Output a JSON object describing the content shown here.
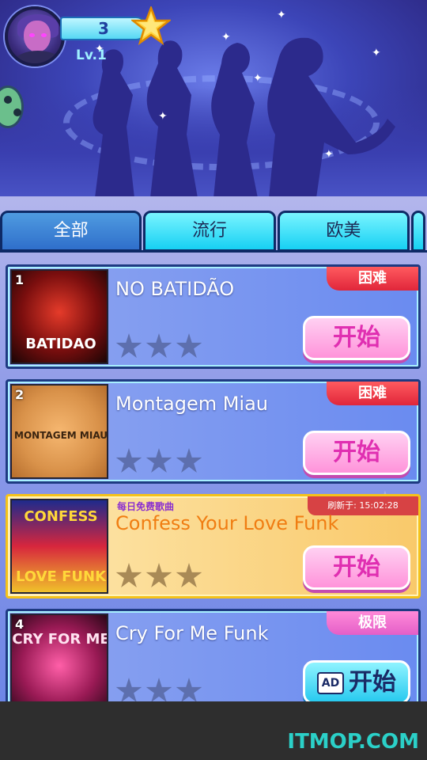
{
  "profile": {
    "score": "3",
    "level": "Lv.1"
  },
  "tabs": [
    {
      "label": "全部",
      "active": true
    },
    {
      "label": "流行",
      "active": false
    },
    {
      "label": "欧美",
      "active": false
    }
  ],
  "songs": [
    {
      "rank": "1",
      "title": "NO BATIDÃO",
      "difficulty": "困难",
      "stars": 3,
      "button": "开始",
      "cover_text": "BATIDAO"
    },
    {
      "rank": "2",
      "title": "Montagem Miau",
      "difficulty": "困难",
      "stars": 3,
      "button": "开始",
      "cover_text": "MONTAGEM MIAU"
    },
    {
      "rank": "",
      "title": "Confess Your Love Funk",
      "featured_label": "每日免费歌曲",
      "refresh_label": "刷新于: 15:02:28",
      "stars": 3,
      "button": "开始",
      "cover_text_top": "CONFESS",
      "cover_text_bottom": "LOVE FUNK"
    },
    {
      "rank": "4",
      "title": "Cry For Me Funk",
      "difficulty": "极限",
      "stars": 3,
      "button": "开始",
      "ad_label": "AD",
      "cover_text": "CRY FOR ME"
    }
  ],
  "watermark": "ITMOP.COM",
  "colors": {
    "accent_cyan": "#17d0f3",
    "start_pink": "#ff93da",
    "difficulty_red": "#e0263a",
    "difficulty_extreme": "#e45fc8"
  }
}
